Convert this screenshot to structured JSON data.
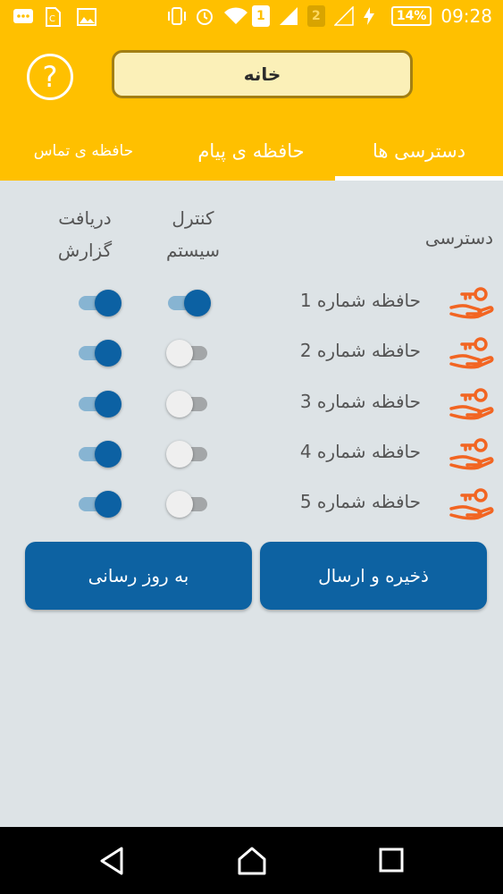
{
  "status_bar": {
    "sim1": "1",
    "sim2": "2",
    "battery": "14%",
    "time": "09:28"
  },
  "header": {
    "home_label": "خانه",
    "help_label": "?"
  },
  "tabs": [
    {
      "label": "دسترسی ها",
      "active": true
    },
    {
      "label": "حافظه ی پیام",
      "active": false
    },
    {
      "label": "حافظه ی تماس",
      "active": false
    }
  ],
  "access": {
    "column_access": "دسترسی",
    "column_control_line1": "کنترل",
    "column_control_line2": "سیستم",
    "column_report_line1": "دریافت",
    "column_report_line2": "گزارش",
    "rows": [
      {
        "label": "حافظه شماره 1",
        "control": true,
        "report": true
      },
      {
        "label": "حافظه شماره 2",
        "control": false,
        "report": true
      },
      {
        "label": "حافظه شماره 3",
        "control": false,
        "report": true
      },
      {
        "label": "حافظه شماره 4",
        "control": false,
        "report": true
      },
      {
        "label": "حافظه شماره 5",
        "control": false,
        "report": true
      }
    ]
  },
  "buttons": {
    "save_send": "ذخیره و ارسال",
    "update": "به روز رسانی"
  },
  "icons": {
    "key": "key-hand-icon",
    "help": "help-icon",
    "back": "back-icon",
    "home": "home-icon",
    "recents": "recents-icon"
  },
  "colors": {
    "header": "#ffc000",
    "primary": "#0d62a2",
    "switch_on_track": "#87b4d2",
    "key_icon": "#f26522",
    "background": "#dde3e6"
  }
}
